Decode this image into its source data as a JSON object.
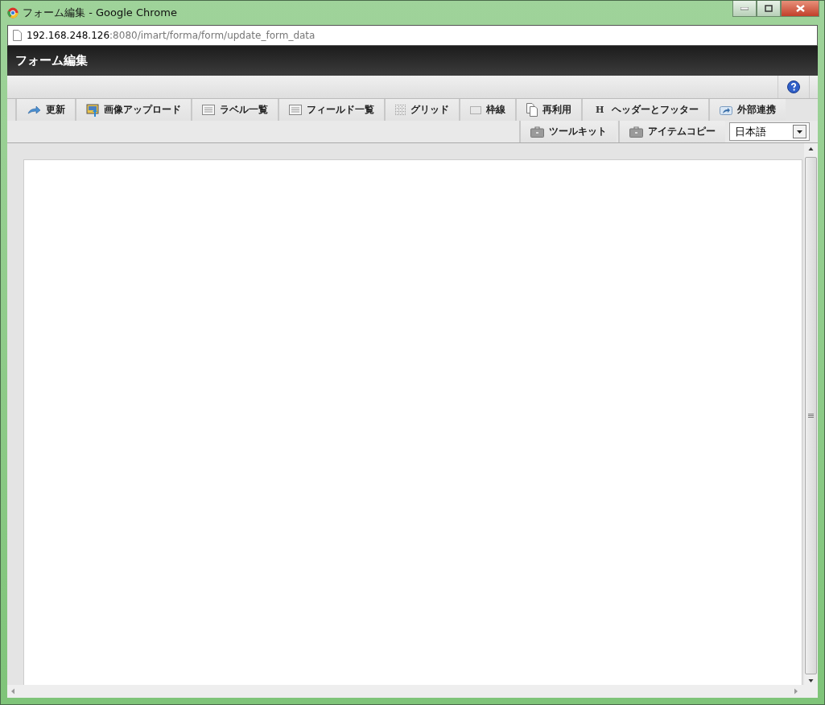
{
  "window": {
    "title": "フォーム編集 - Google Chrome"
  },
  "address_bar": {
    "host": "192.168.248.126",
    "path": ":8080/imart/forma/form/update_form_data"
  },
  "header": {
    "title": "フォーム編集"
  },
  "toolbar": {
    "buttons": [
      {
        "kind": "refresh",
        "label": "更新"
      },
      {
        "kind": "upload",
        "label": "画像アップロード"
      },
      {
        "kind": "list",
        "label": "ラベル一覧"
      },
      {
        "kind": "list",
        "label": "フィールド一覧"
      },
      {
        "kind": "grid",
        "label": "グリッド"
      },
      {
        "kind": "border",
        "label": "枠線"
      },
      {
        "kind": "reuse",
        "label": "再利用"
      },
      {
        "kind": "letter",
        "icon_text": "H",
        "label": "ヘッダーとフッター"
      },
      {
        "kind": "share",
        "label": "外部連携"
      }
    ],
    "secondary_buttons": [
      {
        "kind": "toolkit",
        "label": "ツールキット"
      },
      {
        "kind": "toolkit",
        "label": "アイテムコピー"
      }
    ],
    "language_select": {
      "value": "日本語"
    }
  }
}
